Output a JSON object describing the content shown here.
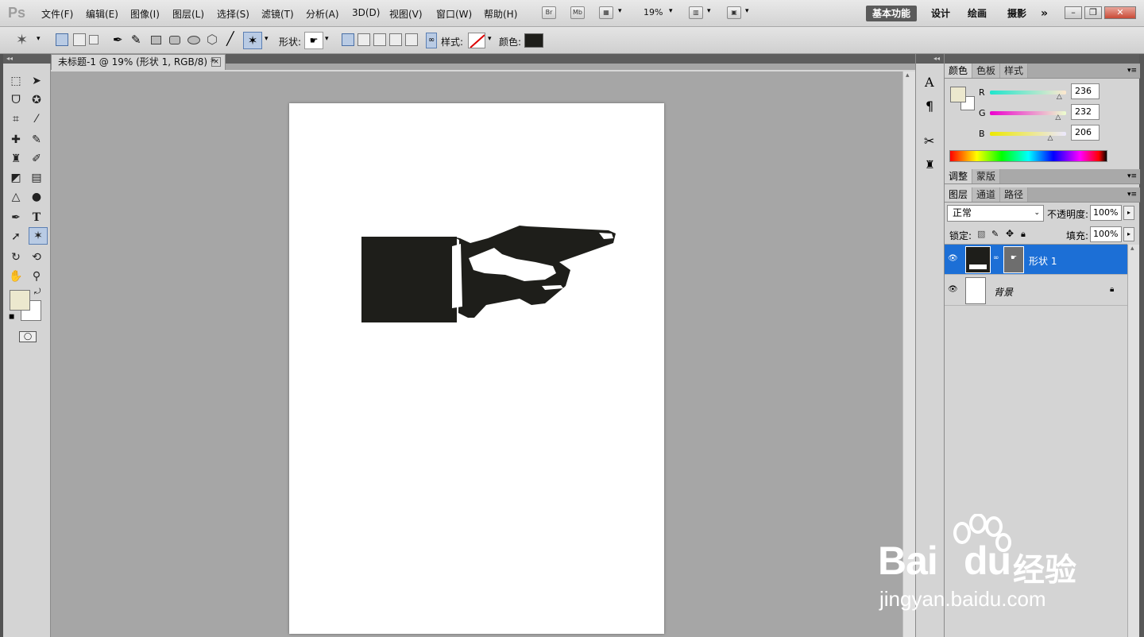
{
  "app": {
    "logo": "Ps"
  },
  "menu": [
    "文件(F)",
    "编辑(E)",
    "图像(I)",
    "图层(L)",
    "选择(S)",
    "滤镜(T)",
    "分析(A)",
    "3D(D)",
    "视图(V)",
    "窗口(W)",
    "帮助(H)"
  ],
  "appbar": {
    "br": "Br",
    "mb": "Mb",
    "zoom": "19%"
  },
  "workspaces": [
    "基本功能",
    "设计",
    "绘画",
    "摄影"
  ],
  "workspace_more": "»",
  "options": {
    "shape_label": "形状:",
    "style_label": "样式:",
    "color_label": "颜色:",
    "color_value": "#1e1e1a"
  },
  "document": {
    "tab_title": "未标题-1 @ 19% (形状 1, RGB/8) *",
    "close": "×"
  },
  "color_panel": {
    "tabs": [
      "颜色",
      "色板",
      "样式"
    ],
    "r_label": "R",
    "g_label": "G",
    "b_label": "B",
    "r": "236",
    "g": "232",
    "b": "206",
    "fg": "#ece8ce",
    "bg": "#ffffff"
  },
  "adjust_panel": {
    "tabs": [
      "调整",
      "蒙版"
    ]
  },
  "layers_panel": {
    "tabs": [
      "图层",
      "通道",
      "路径"
    ],
    "blend_mode": "正常",
    "opacity_label": "不透明度:",
    "opacity": "100%",
    "lock_label": "锁定:",
    "fill_label": "填充:",
    "fill": "100%"
  },
  "layers": [
    {
      "name": "形状 1",
      "selected": true
    },
    {
      "name": "背景",
      "selected": false
    }
  ],
  "watermark": {
    "brand": "Bai",
    "brand2": "du",
    "cn": "经验",
    "url": "jingyan.baidu.com"
  }
}
